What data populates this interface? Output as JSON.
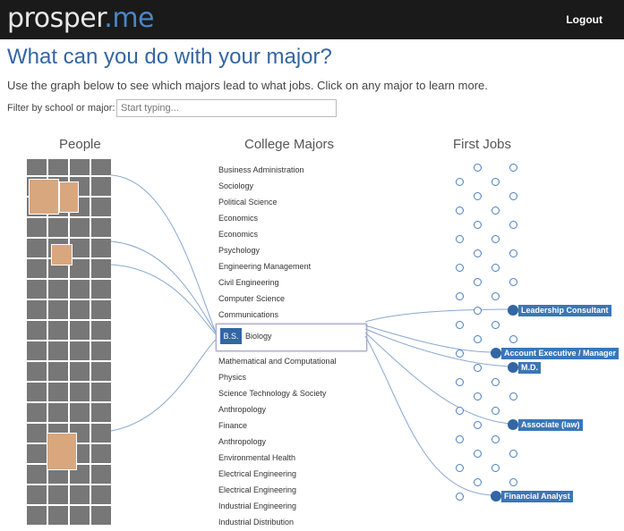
{
  "app": {
    "logo_main": "prosper",
    "logo_dot": ".me",
    "logout": "Logout"
  },
  "page": {
    "title": "What can you do with your major?",
    "subtitle": "Use the graph below to see which majors lead to what jobs. Click on any major to learn more.",
    "filter_label": "Filter by school or major:",
    "filter_placeholder": "Start typing..."
  },
  "columns": {
    "people": "People",
    "majors": "College Majors",
    "jobs": "First Jobs"
  },
  "majors_before": [
    "Business Administration",
    "Sociology",
    "Political Science",
    "Economics",
    "Economics",
    "Psychology",
    "Engineering Management",
    "Civil Engineering",
    "Computer Science",
    "Communications"
  ],
  "selected_major": {
    "degree": "B.S.",
    "name": "Biology"
  },
  "majors_after": [
    "Mathematical and Computational",
    "Physics",
    "Science Technology & Society",
    "Anthropology",
    "Finance",
    "Anthropology",
    "Environmental Health",
    "Electrical Engineering",
    "Electrical Engineering",
    "Industrial Engineering",
    "Industrial Distribution"
  ],
  "jobs": [
    {
      "label": "Leadership Consultant"
    },
    {
      "label": "Account Executive / Manager"
    },
    {
      "label": "M.D."
    },
    {
      "label": "Associate (law)"
    },
    {
      "label": "Financial Analyst"
    }
  ],
  "colors": {
    "accent": "#3366a3",
    "topbar": "#1a1a1a",
    "label_bg": "#3a76b8"
  }
}
